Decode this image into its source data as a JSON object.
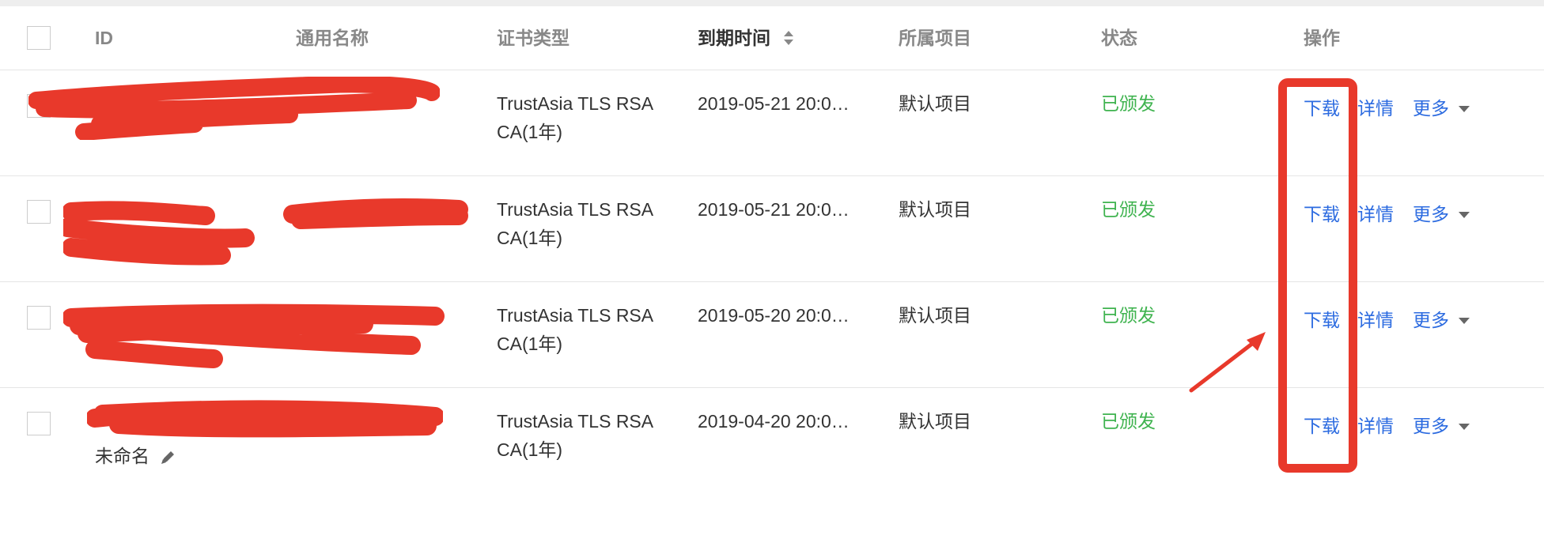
{
  "table": {
    "headers": {
      "id": "ID",
      "name": "通用名称",
      "type": "证书类型",
      "expiry": "到期时间",
      "project": "所属项目",
      "status": "状态",
      "ops": "操作"
    },
    "rows": [
      {
        "id_line2": "",
        "type_line1": "TrustAsia TLS RSA",
        "type_line2": "CA(1年)",
        "expiry": "2019-05-21 20:0…",
        "project": "默认项目",
        "status": "已颁发"
      },
      {
        "id_line2": "",
        "type_line1": "TrustAsia TLS RSA",
        "type_line2": "CA(1年)",
        "expiry": "2019-05-21 20:0…",
        "project": "默认项目",
        "status": "已颁发"
      },
      {
        "id_line2": "",
        "type_line1": "TrustAsia TLS RSA",
        "type_line2": "CA(1年)",
        "expiry": "2019-05-20 20:0…",
        "project": "默认项目",
        "status": "已颁发"
      },
      {
        "id_line2": "未命名",
        "type_line1": "TrustAsia TLS RSA",
        "type_line2": "CA(1年)",
        "expiry": "2019-04-20 20:0…",
        "project": "默认项目",
        "status": "已颁发"
      }
    ],
    "ops": {
      "download": "下载",
      "details": "详情",
      "more": "更多"
    }
  },
  "colors": {
    "status_issued": "#3fb34f",
    "link": "#2c6be0",
    "annotation": "#e8392b",
    "header_text": "#888888"
  },
  "icons": [
    "sort-icon",
    "chevron-down-icon",
    "edit-icon",
    "checkbox"
  ]
}
